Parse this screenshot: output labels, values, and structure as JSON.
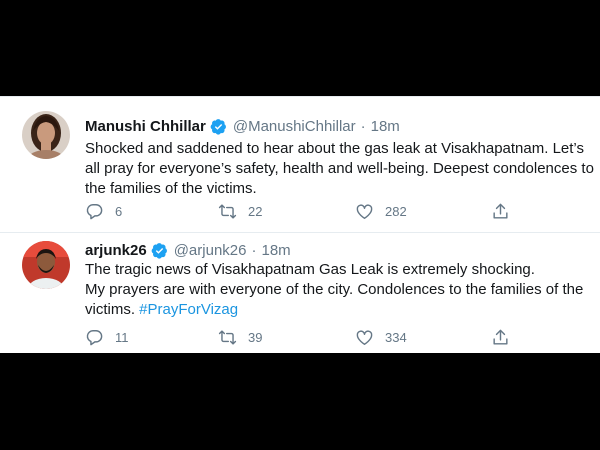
{
  "colors": {
    "verified_badge": "#1da1f2",
    "hashtag": "#1b95e0",
    "secondary_text": "#657786",
    "primary_text": "#14171a"
  },
  "tweets": [
    {
      "name": "Manushi Chhillar",
      "handle": "@ManushiChhillar",
      "separator": "·",
      "time": "18m",
      "verified": true,
      "text_lines": [
        "Shocked and saddened to hear about the gas leak at Visakhapatnam. Let’s",
        "all pray for everyone’s safety, health and well-being. Deepest condolences to",
        "the families of the victims."
      ],
      "replies": "6",
      "retweets": "22",
      "likes": "282",
      "icons": [
        "reply-icon",
        "retweet-icon",
        "like-icon",
        "share-icon"
      ]
    },
    {
      "name": "arjunk26",
      "handle": "@arjunk26",
      "separator": "·",
      "time": "18m",
      "verified": true,
      "text_lines": [
        "The tragic news of Visakhapatnam Gas Leak is extremely shocking.",
        "My prayers are with everyone of the city. Condolences to the families of the"
      ],
      "text_last_prefix": "victims. ",
      "hashtag": "#PrayForVizag",
      "replies": "11",
      "retweets": "39",
      "likes": "334",
      "icons": [
        "reply-icon",
        "retweet-icon",
        "like-icon",
        "share-icon"
      ]
    }
  ]
}
